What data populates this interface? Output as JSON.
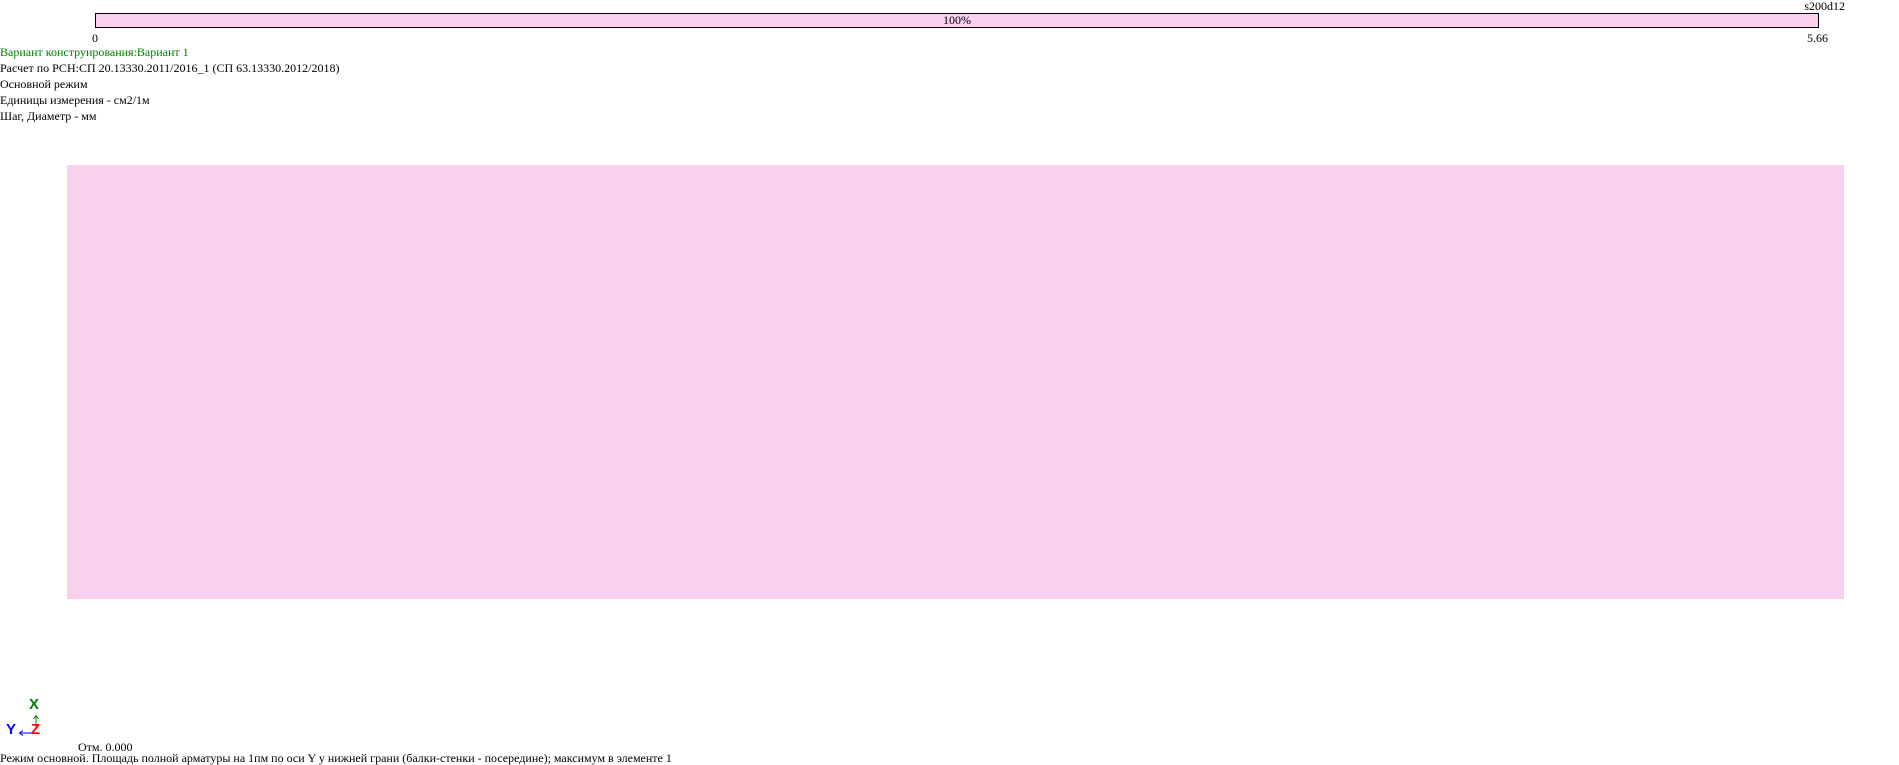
{
  "legend": {
    "scale_label": "s200d12",
    "bar_percent_label": "100%",
    "min_label": "0",
    "max_label": "5.66",
    "fill_color": "#f9d0ee"
  },
  "info": {
    "variant": "Вариант конструирования:Вариант 1",
    "variant_color": "#008000",
    "norm": "Расчет по РСН:СП 20.13330.2011/2016_1 (СП 63.13330.2012/2018)",
    "mode": "Основной режим",
    "units": "Единицы измерения - см2/1м",
    "step": "Шаг, Диаметр - мм"
  },
  "plate": {
    "fill_color": "#f9d0ee"
  },
  "axes": {
    "x_label": "X",
    "y_label": "Y",
    "z_label": "Z",
    "x_color": "#008000",
    "y_color": "#0000ff",
    "z_color": "#ff0000"
  },
  "elevation": "Отм. 0.000",
  "footer": "Режим основной. Площадь полной арматуры на 1пм по оси Y у нижней грани (балки-стенки - посередине); максимум в элементе 1"
}
